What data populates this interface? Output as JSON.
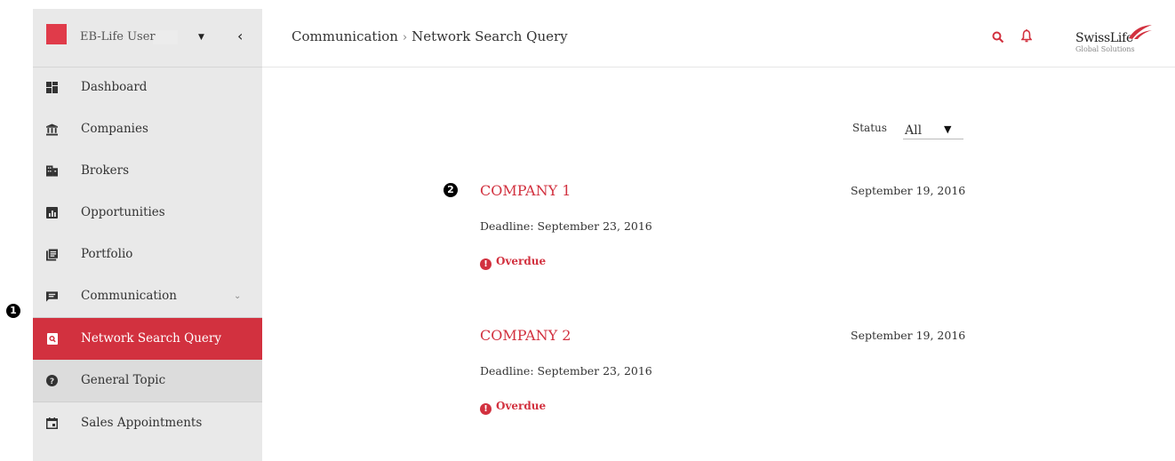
{
  "user": {
    "name": "EB-Life User"
  },
  "sidebar": {
    "items": [
      {
        "label": "Dashboard",
        "icon": "dashboard-icon"
      },
      {
        "label": "Companies",
        "icon": "bank-icon"
      },
      {
        "label": "Brokers",
        "icon": "brokers-icon"
      },
      {
        "label": "Opportunities",
        "icon": "chart-icon"
      },
      {
        "label": "Portfolio",
        "icon": "portfolio-icon"
      },
      {
        "label": "Communication",
        "icon": "message-icon"
      },
      {
        "label": "Network Search Query",
        "icon": "search-doc-icon",
        "active": true
      },
      {
        "label": "General Topic",
        "icon": "help-icon"
      },
      {
        "label": "Sales Appointments",
        "icon": "calendar-icon"
      }
    ]
  },
  "breadcrumb": {
    "parent": "Communication",
    "current": "Network Search Query"
  },
  "header": {
    "logo_text": "SwissLife",
    "logo_sub": "Global Solutions"
  },
  "filter": {
    "label": "Status",
    "value": "All"
  },
  "annotations": {
    "one": "1",
    "two": "2"
  },
  "queries": [
    {
      "company": "COMPANY 1",
      "date": "September 19, 2016",
      "deadline": "Deadline: September 23, 2016",
      "status": "Overdue"
    },
    {
      "company": "COMPANY 2",
      "date": "September 19, 2016",
      "deadline": "Deadline: September 23, 2016",
      "status": "Overdue"
    }
  ],
  "colors": {
    "accent": "#d2313f",
    "sidebar_bg": "#e9e9e9"
  }
}
